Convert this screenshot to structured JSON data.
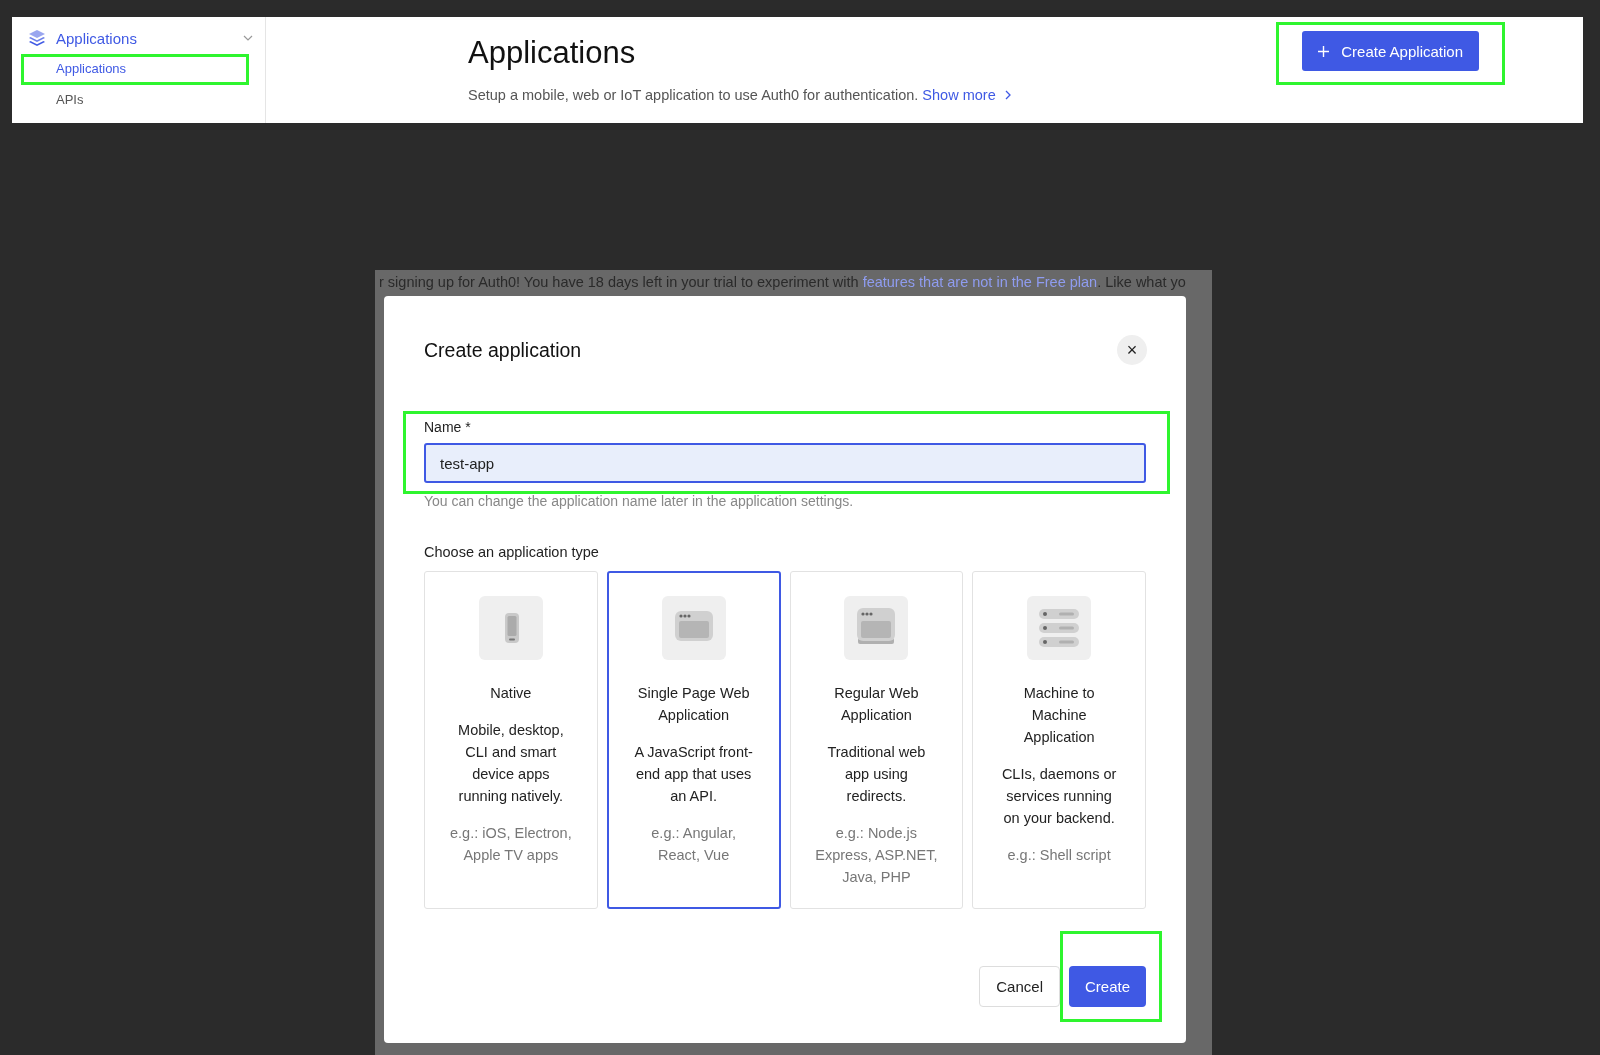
{
  "sidebar": {
    "section": {
      "label": "Applications",
      "expanded": true
    },
    "items": [
      {
        "label": "Applications",
        "selected": true,
        "highlighted": true
      },
      {
        "label": "APIs",
        "selected": false,
        "highlighted": false
      }
    ]
  },
  "header": {
    "title": "Applications",
    "description": "Setup a mobile, web or IoT application to use Auth0 for authentication.",
    "link": "Show more",
    "button": {
      "label": "Create Application",
      "highlighted": true
    }
  },
  "background_notice": {
    "text": "r signing up for Auth0! You have 18 days left in your trial to experiment with ",
    "link": "features that are not in the Free plan",
    "tail": ". Like what yo"
  },
  "dialog": {
    "title": "Create application",
    "close": "×",
    "name_field": {
      "label": "Name *",
      "value": "test-app",
      "highlighted": true
    },
    "hint": "You can change the application name later in the application settings.",
    "type_prompt": "Choose an application type",
    "types": [
      {
        "kind": "native",
        "title": "Native",
        "description": "Mobile, desktop, CLI and smart device apps running natively.",
        "examples": "e.g.: iOS, Electron, Apple TV apps",
        "selected": false
      },
      {
        "kind": "spa",
        "title": "Single Page Web Application",
        "description": "A JavaScript front-end app that uses an API.",
        "examples": "e.g.: Angular, React, Vue",
        "selected": true
      },
      {
        "kind": "regular",
        "title": "Regular Web Application",
        "description": "Traditional web app using redirects.",
        "examples": "e.g.: Node.js Express, ASP.NET, Java, PHP",
        "selected": false
      },
      {
        "kind": "m2m",
        "title": "Machine to Machine Application",
        "description": "CLIs, daemons or services running on your backend.",
        "examples": "e.g.: Shell script",
        "selected": false
      }
    ],
    "buttons": [
      {
        "kind": "secondary",
        "label": "Cancel",
        "highlighted": false
      },
      {
        "kind": "primary",
        "label": "Create",
        "highlighted": true
      }
    ]
  }
}
